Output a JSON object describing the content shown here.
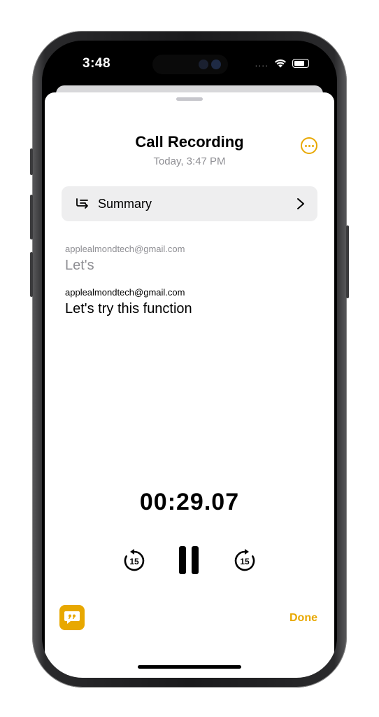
{
  "status_bar": {
    "time": "3:48",
    "signal": "...."
  },
  "header": {
    "title": "Call Recording",
    "subtitle": "Today, 3:47 PM"
  },
  "summary": {
    "label": "Summary"
  },
  "transcript": [
    {
      "speaker": "applealmondtech@gmail.com",
      "text": "Let's"
    },
    {
      "speaker": "applealmondtech@gmail.com",
      "text": "Let's try this function"
    }
  ],
  "player": {
    "elapsed": "00:29.07",
    "skip_back_seconds": "15",
    "skip_forward_seconds": "15"
  },
  "footer": {
    "done_label": "Done"
  },
  "icons": {
    "more": "ellipsis-circle-icon",
    "summary": "summary-list-icon",
    "chevron": "chevron-right-icon",
    "skip_back": "gobackward-15-icon",
    "pause": "pause-icon",
    "skip_forward": "goforward-15-icon",
    "quote": "quote-bubble-icon"
  },
  "colors": {
    "accent": "#E8A800",
    "secondary_text": "#8E8E93",
    "row_bg": "#EEEEEF"
  }
}
